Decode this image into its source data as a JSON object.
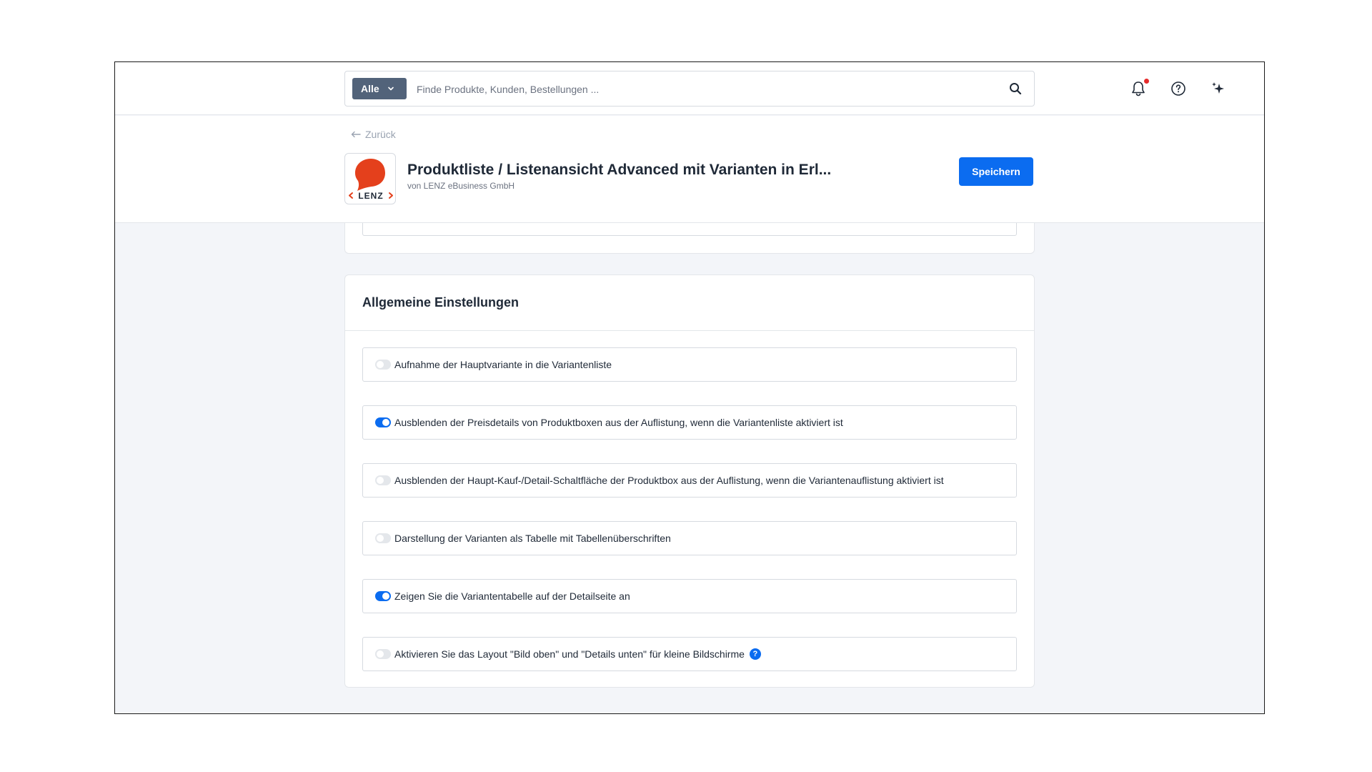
{
  "topbar": {
    "search_scope": "Alle",
    "search_placeholder": "Finde Produkte, Kunden, Bestellungen ...",
    "search_value": "",
    "icons": [
      "bell-icon",
      "help-icon",
      "sparkle-icon"
    ],
    "notification_dot_color": "#e52b2b"
  },
  "header": {
    "back_label": "Zurück",
    "title": "Produktliste / Listenansicht Advanced mit Varianten in Erl...",
    "subtitle": "von LENZ eBusiness GmbH",
    "logo_text": "‹LENZ›",
    "save_label": "Speichern"
  },
  "settings": {
    "title": "Allgemeine Einstellungen",
    "options": [
      {
        "label": "Aufnahme der Hauptvariante in die Variantenliste",
        "enabled": false
      },
      {
        "label": "Ausblenden der Preisdetails von Produktboxen aus der Auflistung, wenn die Variantenliste aktiviert ist",
        "enabled": true
      },
      {
        "label": "Ausblenden der Haupt-Kauf-/Detail-Schaltfläche der Produktbox aus der Auflistung, wenn die Variantenauflistung aktiviert ist",
        "enabled": false
      },
      {
        "label": "Darstellung der Varianten als Tabelle mit Tabellenüberschriften",
        "enabled": false
      },
      {
        "label": "Zeigen Sie die Variantentabelle auf der Detailseite an",
        "enabled": true
      },
      {
        "label": "Aktivieren Sie das Layout \"Bild oben\" und \"Details unten\" für kleine Bildschirme",
        "enabled": false,
        "info": "?"
      }
    ]
  },
  "colors": {
    "accent": "#0b6cf0",
    "scope_select": "#52637a",
    "logo_red": "#e4401c",
    "background": "#f3f5f9"
  }
}
